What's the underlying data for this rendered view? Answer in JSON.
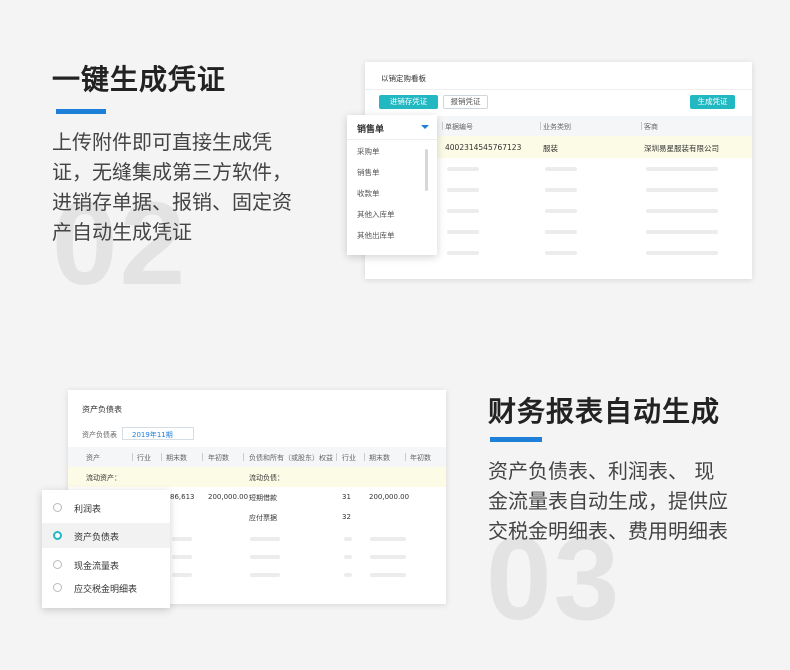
{
  "section1": {
    "number": "02",
    "title": "一键生成凭证",
    "desc_lines": [
      "上传附件即可直接生成凭",
      "证，无缝集成第三方软件，",
      "进销存单据、报销、固定资",
      "产自动生成凭证"
    ],
    "panel": {
      "title": "以销定购看板",
      "btn_inventory": "进销存凭证",
      "btn_expense": "报销凭证",
      "btn_generate": "生成凭证",
      "headers": [
        "单据编号",
        "业务类别",
        "客商"
      ],
      "row": {
        "code": "4002314545767123",
        "category": "服装",
        "merchant": "深圳易星服装有限公司"
      },
      "dropdown": {
        "selected": "销售单",
        "options": [
          "采购单",
          "销售单",
          "收款单",
          "其他入库单",
          "其他出库单"
        ]
      }
    }
  },
  "section2": {
    "number": "03",
    "title": "财务报表自动生成",
    "desc_lines": [
      "资产负债表、利润表、 现",
      "金流量表自动生成，提供应",
      "交税金明细表、费用明细表"
    ],
    "panel": {
      "title": "资产负债表",
      "filter_label": "资产负债表",
      "period": "2019年11期",
      "headers": [
        "资产",
        "行业",
        "期末数",
        "年初数",
        "负债和所有（或股东）权益",
        "行业",
        "期末数",
        "年初数"
      ],
      "section_left": "流动资产：",
      "section_right": "流动负债：",
      "row1": {
        "end": "86,613",
        "begin": "200,000.00",
        "liab": "短期借款",
        "line": "31",
        "liab_end": "200,000.00"
      },
      "row2": {
        "liab": "应付票据",
        "line": "32"
      },
      "menu": [
        {
          "label": "利润表",
          "selected": false
        },
        {
          "label": "资产负债表",
          "selected": true
        },
        {
          "label": "现金流量表",
          "selected": false
        },
        {
          "label": "应交税金明细表",
          "selected": false
        }
      ]
    }
  }
}
